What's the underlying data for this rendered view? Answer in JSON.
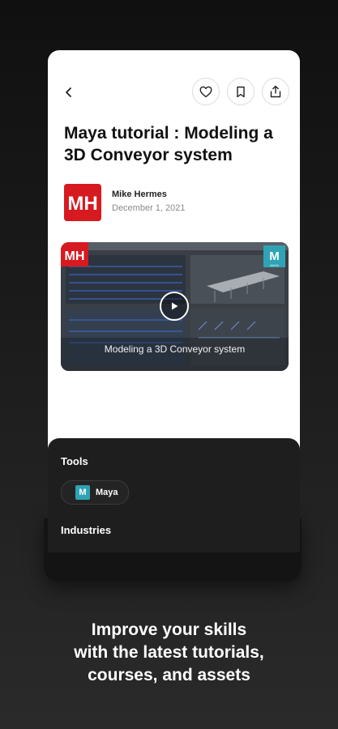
{
  "article": {
    "title": "Maya tutorial : Modeling a 3D Conveyor system",
    "author_name": "Mike Hermes",
    "date": "December 1, 2021",
    "avatar_text": "MH"
  },
  "video": {
    "caption": "Modeling a 3D Conveyor system",
    "logo_text": "MH",
    "badge_text": "M",
    "badge_subtext": "MAYA"
  },
  "sheet": {
    "tools_label": "Tools",
    "tool_chip_label": "Maya",
    "tool_chip_icon": "M",
    "industries_label": "Industries"
  },
  "tagline": {
    "line1": "Improve your skills",
    "line2": "with the latest tutorials,",
    "line3": "courses, and assets"
  },
  "icons": {
    "back": "chevron-left-icon",
    "favorite": "heart-icon",
    "bookmark": "bookmark-icon",
    "share": "share-icon",
    "play": "play-icon"
  },
  "colors": {
    "background": "#1a1a1a",
    "card": "#ffffff",
    "sheet": "#1e1e1e",
    "brand_red": "#d71920",
    "maya_teal": "#2fa3b5"
  }
}
